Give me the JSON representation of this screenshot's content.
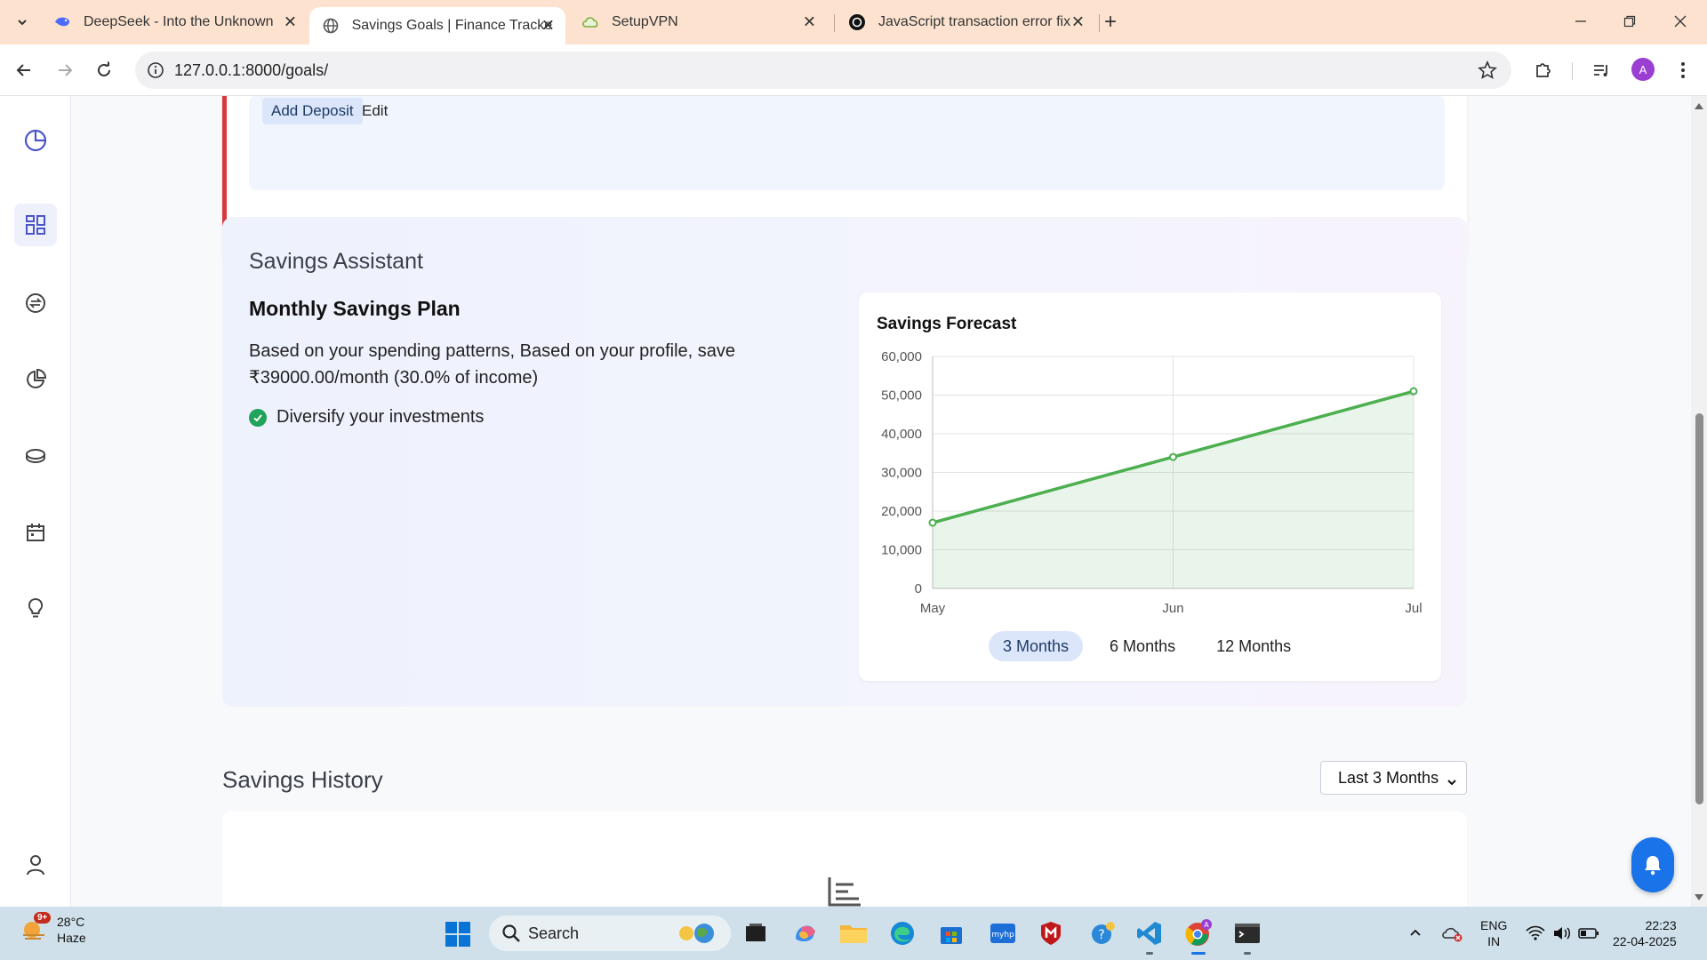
{
  "browser": {
    "tabs": [
      {
        "title": "DeepSeek - Into the Unknown",
        "active": false
      },
      {
        "title": "Savings Goals | Finance Tracker",
        "active": true
      },
      {
        "title": "SetupVPN",
        "active": false
      },
      {
        "title": "JavaScript transaction error fix",
        "active": false
      }
    ],
    "url": "127.0.0.1:8000/goals/",
    "profile_initial": "A"
  },
  "sidebar": {
    "items": [
      {
        "icon": "pie-chart-icon",
        "active": false
      },
      {
        "icon": "dashboard-grid-icon",
        "active": true
      },
      {
        "icon": "transactions-icon",
        "active": false
      },
      {
        "icon": "reports-pie-icon",
        "active": false
      },
      {
        "icon": "savings-coins-icon",
        "active": false
      },
      {
        "icon": "calendar-icon",
        "active": false
      },
      {
        "icon": "lightbulb-icon",
        "active": false
      },
      {
        "icon": "user-profile-icon",
        "active": false
      }
    ]
  },
  "goal_card": {
    "add_deposit": "Add Deposit",
    "edit": "Edit",
    "accent_color": "#d8393c"
  },
  "assistant": {
    "heading": "Savings Assistant",
    "plan_title": "Monthly Savings Plan",
    "plan_description": "Based on your spending patterns, Based on your profile, save ₹39000.00/month (30.0% of income)",
    "tips": [
      "Diversify your investments"
    ]
  },
  "forecast": {
    "title": "Savings Forecast",
    "range_buttons": [
      "3 Months",
      "6 Months",
      "12 Months"
    ],
    "active_range": "3 Months"
  },
  "chart_data": {
    "type": "area",
    "title": "Savings Forecast",
    "categories": [
      "May",
      "Jun",
      "Jul"
    ],
    "series": [
      {
        "values": [
          17000,
          34000,
          51000
        ],
        "color": "#4caf50"
      }
    ],
    "ylim": [
      0,
      60000
    ],
    "yticks": [
      0,
      10000,
      20000,
      30000,
      40000,
      50000,
      60000
    ],
    "ytick_labels": [
      "0",
      "10,000",
      "20,000",
      "30,000",
      "40,000",
      "50,000",
      "60,000"
    ],
    "grid": true,
    "legend": "none"
  },
  "history": {
    "heading": "Savings History",
    "period_selected": "Last 3 Months"
  },
  "taskbar": {
    "weather_temp": "28°C",
    "weather_desc": "Haze",
    "weather_badge": "9+",
    "search_label": "Search",
    "lang_line1": "ENG",
    "lang_line2": "IN",
    "time": "22:23",
    "date": "22-04-2025"
  }
}
